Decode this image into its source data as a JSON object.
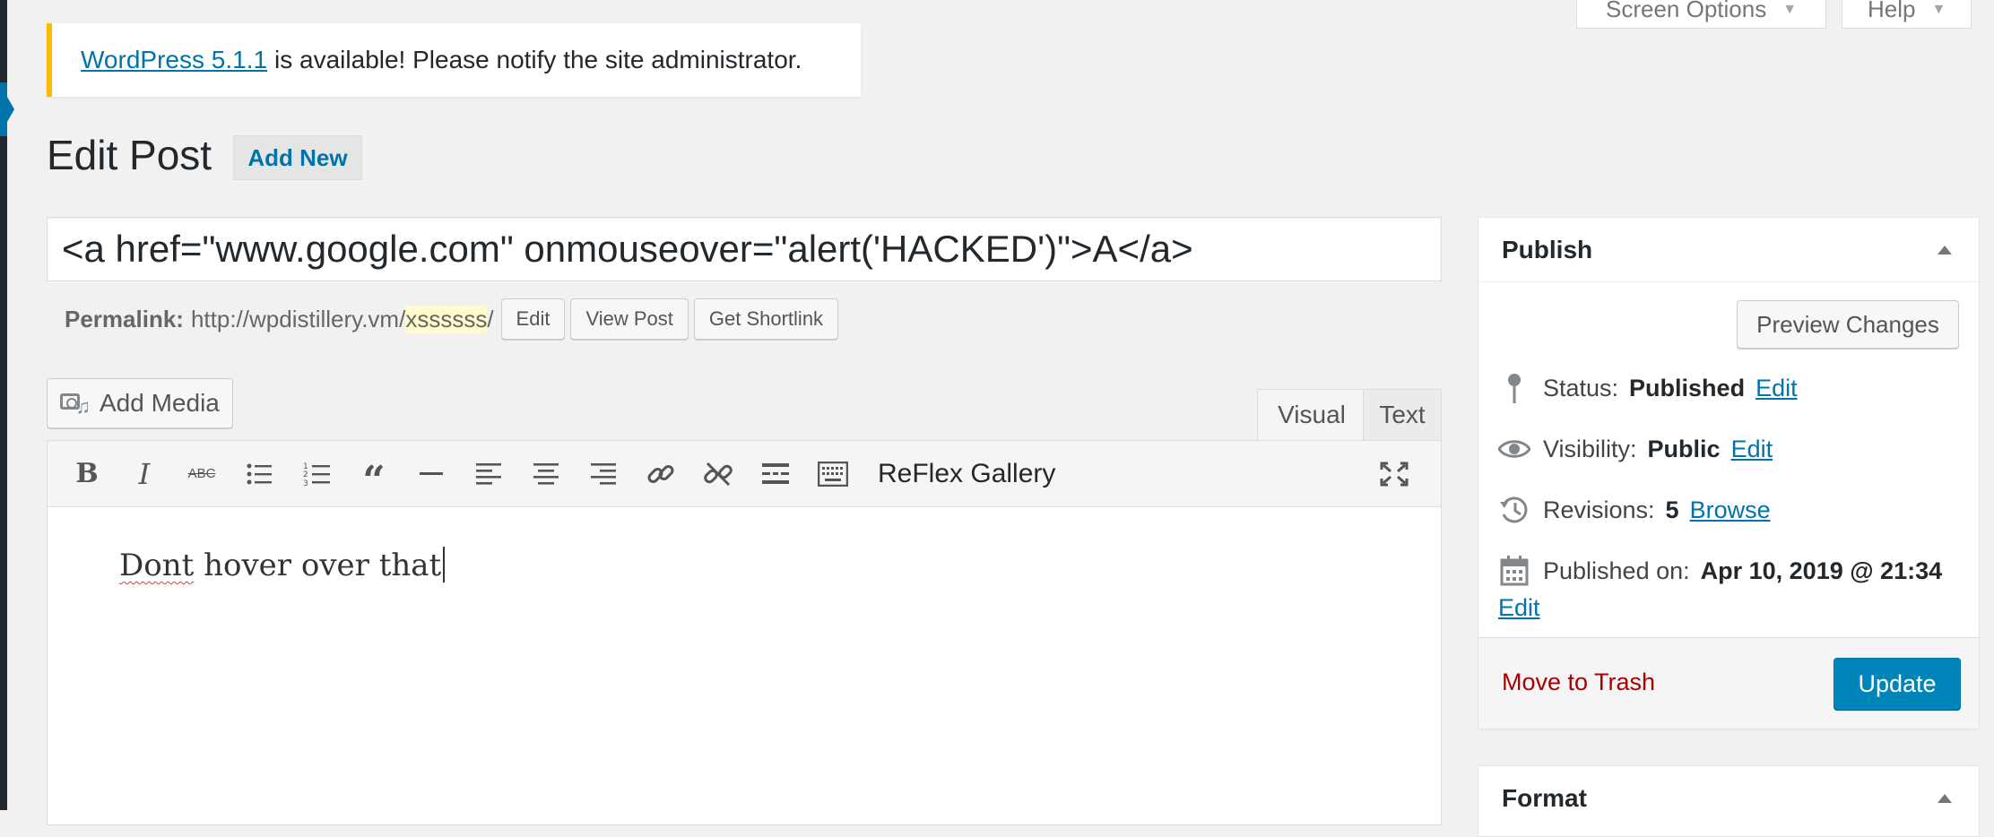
{
  "screen_meta": {
    "screen_options_label": "Screen Options",
    "help_label": "Help"
  },
  "notice": {
    "link_text": "WordPress 5.1.1",
    "message": "is available! Please notify the site administrator."
  },
  "heading": {
    "title": "Edit Post",
    "add_new_label": "Add New"
  },
  "post": {
    "title_value": "<a href=\"www.google.com\" onmouseover=\"alert('HACKED')\">A</a>",
    "body_misspelled_word": "Dont",
    "body_rest": " hover over that"
  },
  "permalink": {
    "label": "Permalink:",
    "base_url": "http://wpdistillery.vm/",
    "slug": "xssssss",
    "trailing": "/",
    "edit_label": "Edit",
    "view_label": "View Post",
    "shortlink_label": "Get Shortlink"
  },
  "media": {
    "add_media_label": "Add Media"
  },
  "editor_tabs": {
    "visual_label": "Visual",
    "text_label": "Text"
  },
  "toolbar": {
    "gallery_label": "ReFlex Gallery",
    "icons": [
      "bold-icon",
      "italic-icon",
      "strikethrough-icon",
      "bullet-list-icon",
      "numbered-list-icon",
      "blockquote-icon",
      "horizontal-line-icon",
      "align-left-icon",
      "align-center-icon",
      "align-right-icon",
      "insert-link-icon",
      "unlink-icon",
      "read-more-icon",
      "toolbar-toggle-icon",
      "fullscreen-icon"
    ]
  },
  "publish_box": {
    "title": "Publish",
    "preview_label": "Preview Changes",
    "status_label": "Status:",
    "status_value": "Published",
    "status_edit": "Edit",
    "visibility_label": "Visibility:",
    "visibility_value": "Public",
    "visibility_edit": "Edit",
    "revisions_label": "Revisions:",
    "revisions_value": "5",
    "revisions_browse": "Browse",
    "published_on_label": "Published on:",
    "published_on_value": "Apr 10, 2019 @ 21:34",
    "published_edit": "Edit",
    "trash_label": "Move to Trash",
    "update_label": "Update"
  },
  "format_box": {
    "title": "Format"
  },
  "colors": {
    "accent": "#0073aa",
    "primary_button": "#0085ba",
    "notice_border": "#ffb900",
    "trash": "#aa0000"
  }
}
